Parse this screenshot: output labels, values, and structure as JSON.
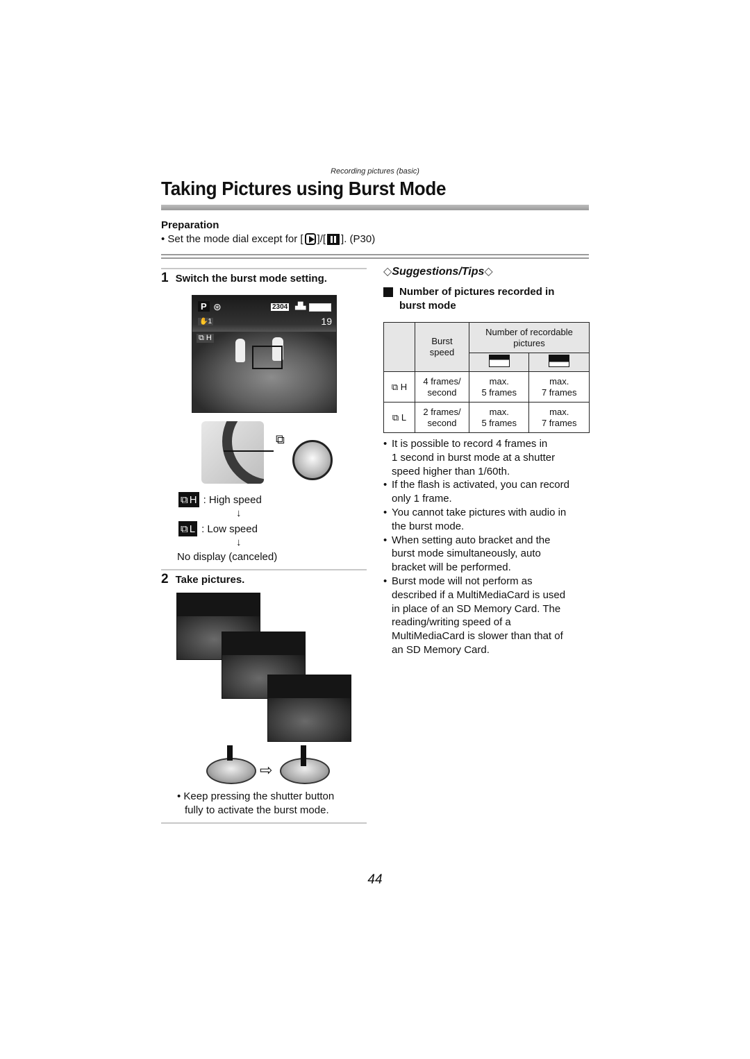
{
  "header": {
    "section_label": "Recording pictures (basic)",
    "title": "Taking Pictures using Burst Mode"
  },
  "preparation": {
    "heading": "Preparation",
    "text_before": "• Set the mode dial except for [",
    "text_mid": "]/[",
    "text_after": "]. (P30)",
    "icons": [
      "playback-mode-icon",
      "motion-picture-mode-icon"
    ]
  },
  "steps": [
    {
      "number": "1",
      "label": "Switch the burst mode setting.",
      "lcd": {
        "mode": "P",
        "resolution": "2304",
        "remaining": "19",
        "stabilizer": "1",
        "burst_indicator": "H"
      },
      "legend": [
        {
          "icon": "burst-high-icon",
          "suffix": "H",
          "label": ": High speed"
        },
        {
          "icon": "burst-low-icon",
          "suffix": "L",
          "label": ": Low speed"
        }
      ],
      "arrow": "↓",
      "final": "No display (canceled)"
    },
    {
      "number": "2",
      "label": "Take pictures.",
      "note": "• Keep pressing the shutter button fully to activate the burst mode.",
      "note_line1": "• Keep pressing the shutter button",
      "note_line2": "fully to activate the burst mode."
    }
  ],
  "tips": {
    "heading": "Suggestions/Tips",
    "subheading_line1": "Number of pictures recorded in",
    "subheading_line2": "burst mode",
    "table": {
      "col_burst_speed": "Burst speed",
      "col_burst_line1": "Burst",
      "col_burst_line2": "speed",
      "col_recordable_line1": "Number of recordable",
      "col_recordable_line2": "pictures",
      "quality_icons": [
        "fine-quality-icon",
        "standard-quality-icon"
      ],
      "rows": [
        {
          "mode": "H",
          "speed_line1": "4 frames/",
          "speed_line2": "second",
          "fine_line1": "max.",
          "fine_line2": "5 frames",
          "std_line1": "max.",
          "std_line2": "7 frames"
        },
        {
          "mode": "L",
          "speed_line1": "2 frames/",
          "speed_line2": "second",
          "fine_line1": "max.",
          "fine_line2": "5 frames",
          "std_line1": "max.",
          "std_line2": "7 frames"
        }
      ]
    },
    "bullets": [
      {
        "line1": "It is possible to record 4 frames in",
        "line2": "1 second in burst mode at a shutter",
        "line3": "speed higher than 1/60th."
      },
      {
        "line1": "If the flash is activated, you can record",
        "line2": "only 1 frame."
      },
      {
        "line1": "You cannot take pictures with audio in",
        "line2": "the burst mode."
      },
      {
        "line1": "When setting auto bracket and the",
        "line2": "burst mode simultaneously, auto",
        "line3": "bracket will be performed."
      },
      {
        "line1": "Burst mode will not perform as",
        "line2": "described if a MultiMediaCard is used",
        "line3": "in place of an SD Memory Card. The",
        "line4": "reading/writing speed of a",
        "line5": "MultiMediaCard is slower than that of",
        "line6": "an SD Memory Card."
      }
    ]
  },
  "footer": {
    "page_number": "44"
  }
}
